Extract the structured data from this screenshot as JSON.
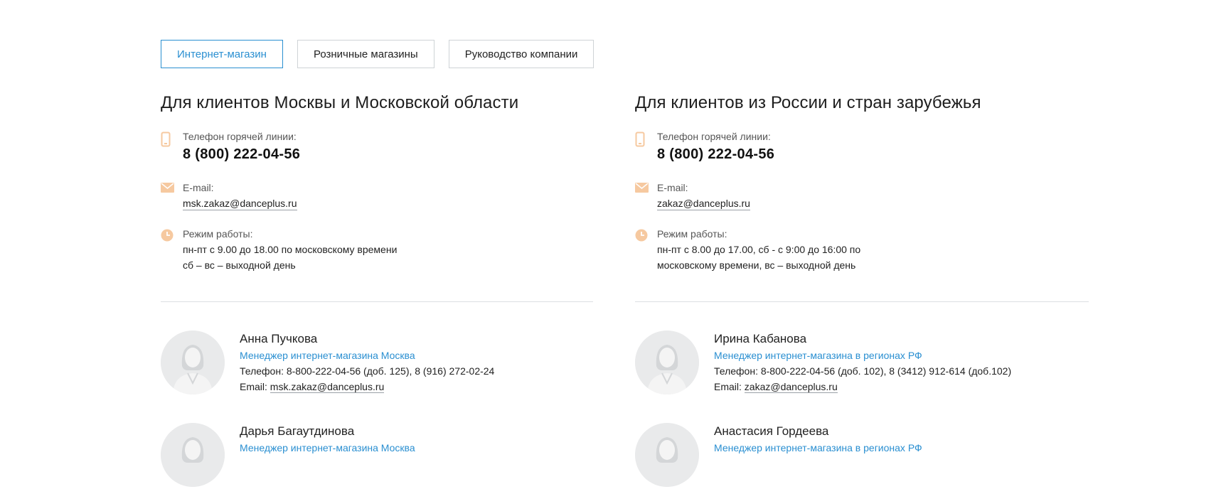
{
  "tabs": [
    {
      "label": "Интернет-магазин",
      "active": true
    },
    {
      "label": "Розничные магазины",
      "active": false
    },
    {
      "label": "Руководство компании",
      "active": false
    }
  ],
  "left": {
    "title": "Для клиентов Москвы и Московской области",
    "hotline_label": "Телефон горячей линии:",
    "hotline_phone": "8 (800) 222-04-56",
    "email_label": "E-mail:",
    "email": "msk.zakaz@danceplus.ru",
    "hours_label": "Режим работы:",
    "hours_line1": "пн-пт с 9.00 до 18.00 по московскому времени",
    "hours_line2": "сб – вс – выходной день"
  },
  "right": {
    "title": "Для клиентов из России и стран зарубежья",
    "hotline_label": "Телефон горячей линии:",
    "hotline_phone": "8 (800) 222-04-56",
    "email_label": "E-mail:",
    "email": "zakaz@danceplus.ru",
    "hours_label": "Режим работы:",
    "hours_line1": "пн-пт с 8.00 до 17.00, сб - с 9:00 до 16:00 по",
    "hours_line2": "московскому времени, вс – выходной день"
  },
  "people": {
    "left1": {
      "name": "Анна Пучкова",
      "role": "Менеджер интернет-магазина Москва",
      "phone_label": "Телефон: ",
      "phone": "8-800-222-04-56 (доб. 125), 8 (916) 272-02-24",
      "email_label": "Email: ",
      "email": "msk.zakaz@danceplus.ru"
    },
    "right1": {
      "name": "Ирина Кабанова",
      "role": "Менеджер интернет-магазина в регионах РФ",
      "phone_label": "Телефон: ",
      "phone": "8-800-222-04-56 (доб. 102), 8 (3412) 912-614 (доб.102)",
      "email_label": "Email: ",
      "email": "zakaz@danceplus.ru"
    },
    "left2": {
      "name": "Дарья Багаутдинова",
      "role": "Менеджер интернет-магазина Москва"
    },
    "right2": {
      "name": "Анастасия Гордеева",
      "role": "Менеджер интернет-магазина в регионах РФ"
    }
  },
  "colors": {
    "accent": "#2a8fd1",
    "icon": "#f6c9a0",
    "avatar_bg": "#e9eaeb"
  },
  "icons": {
    "phone": "phone-icon",
    "mail": "mail-icon",
    "clock": "clock-icon",
    "avatar": "user-avatar-icon"
  }
}
